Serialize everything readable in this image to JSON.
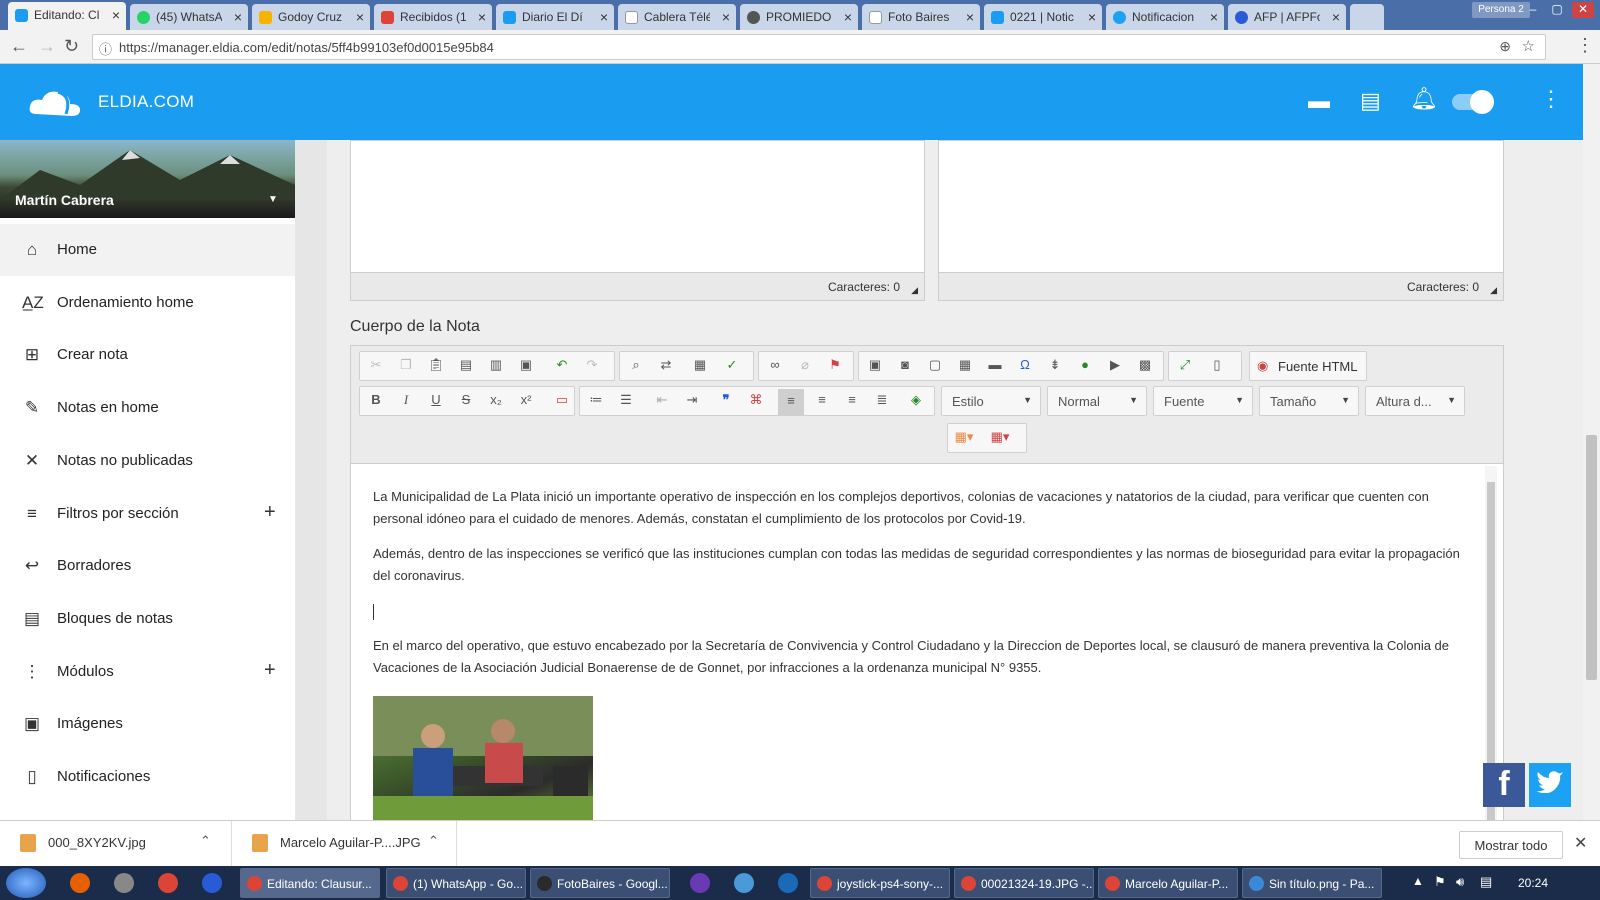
{
  "browser": {
    "tabs": [
      {
        "label": "Editando: Cl",
        "active": true
      },
      {
        "label": "(45) WhatsA"
      },
      {
        "label": "Godoy Cruz"
      },
      {
        "label": "Recibidos (1"
      },
      {
        "label": "Diario El Dí"
      },
      {
        "label": "Cablera Télé"
      },
      {
        "label": "PROMIEDOS"
      },
      {
        "label": "Foto Baires"
      },
      {
        "label": "0221 | Notic"
      },
      {
        "label": "Notificacion"
      },
      {
        "label": "AFP | AFPFo"
      }
    ],
    "profile": "Persona 2",
    "url": "https://manager.eldia.com/edit/notas/5ff4b99103ef0d0015e95b84"
  },
  "header": {
    "logo": "ELDIA.COM"
  },
  "sidebar": {
    "user": "Martín Cabrera",
    "items": [
      {
        "label": "Home",
        "icon": "home-icon",
        "glyph": "⌂"
      },
      {
        "label": "Ordenamiento home",
        "icon": "sort-az-icon",
        "glyph": "A̲Z"
      },
      {
        "label": "Crear nota",
        "icon": "add-note-icon",
        "glyph": "⊞"
      },
      {
        "label": "Notas en home",
        "icon": "pencil-icon",
        "glyph": "✎"
      },
      {
        "label": "Notas no publicadas",
        "icon": "close-icon",
        "glyph": "✕"
      },
      {
        "label": "Filtros por sección",
        "icon": "filter-icon",
        "glyph": "≡",
        "plus": "+"
      },
      {
        "label": "Borradores",
        "icon": "reply-icon",
        "glyph": "↩"
      },
      {
        "label": "Bloques de notas",
        "icon": "library-icon",
        "glyph": "▤"
      },
      {
        "label": "Módulos",
        "icon": "dots-vertical-icon",
        "glyph": "⋮",
        "plus": "+"
      },
      {
        "label": "Imágenes",
        "icon": "images-icon",
        "glyph": "▣"
      },
      {
        "label": "Notificaciones",
        "icon": "phone-icon",
        "glyph": "▯"
      }
    ]
  },
  "editor": {
    "counter_left": "Caracteres: 0",
    "counter_right": "Caracteres: 0",
    "section_title": "Cuerpo de la Nota",
    "source_button": "Fuente HTML",
    "combos": [
      "Estilo",
      "Normal",
      "Fuente",
      "Tamaño",
      "Altura d..."
    ],
    "paragraphs": [
      "La Municipalidad de La Plata inició un importante operativo de inspección en los complejos deportivos, colonias de vacaciones y natatorios de la ciudad, para verificar que cuenten con personal idóneo para el cuidado de menores. Además, constatan el cumplimiento de los protocolos por Covid-19.",
      "Además, dentro de las inspecciones se verificó que las instituciones cumplan con todas las medidas de seguridad correspondientes y las normas de bioseguridad para evitar la propagación del coronavirus.",
      "",
      "En el marco del operativo, que estuvo encabezado por la Secretaría de Convivencia y Control Ciudadano y la Direccion de Deportes local, se clausuró de manera preventiva la Colonia de Vacaciones de la Asociación Judicial Bonaerense de de Gonnet, por infracciones a la ordenanza municipal N° 9355."
    ]
  },
  "downloads": {
    "items": [
      "000_8XY2KV.jpg",
      "Marcelo Aguilar-P....JPG"
    ],
    "show_all": "Mostrar todo"
  },
  "taskbar": {
    "items": [
      "Editando: Clausur...",
      "(1) WhatsApp - Go...",
      "FotoBaires - Googl...",
      "joystick-ps4-sony-...",
      "00021324-19.JPG -...",
      "Marcelo Aguilar-P...",
      "Sin título.png - Pa..."
    ],
    "clock": "20:24"
  },
  "colors": {
    "header": "#1a9cf0",
    "facebook": "#3b5998",
    "twitter": "#1da1f2"
  }
}
